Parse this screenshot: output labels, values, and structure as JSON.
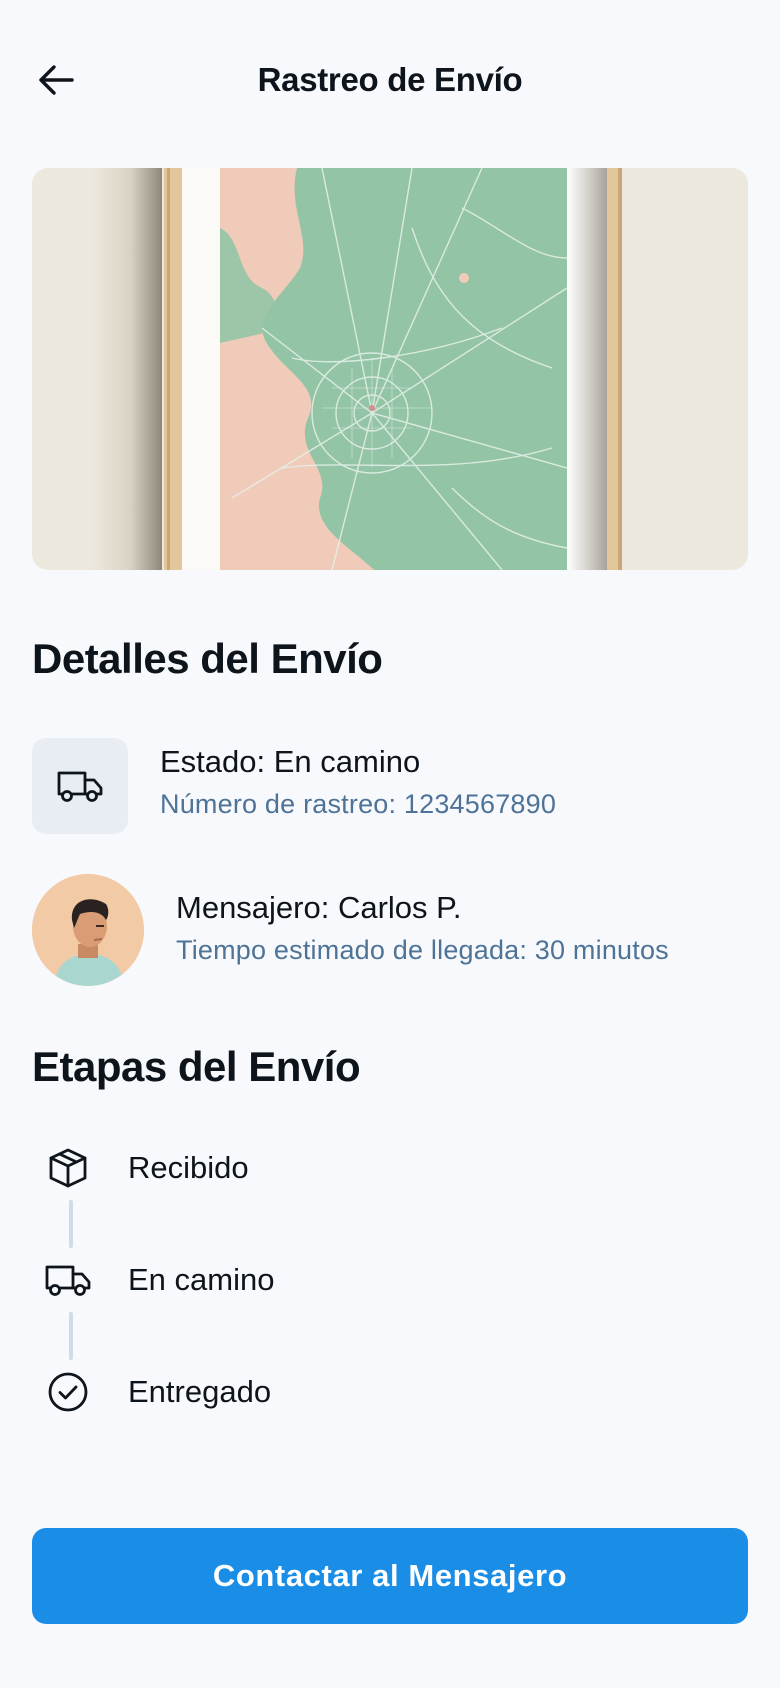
{
  "header": {
    "title": "Rastreo de Envío",
    "back_icon": "arrow-left-icon"
  },
  "map": {
    "icon": "map-image",
    "colors": {
      "land": "#f0cbb9",
      "green": "#93c4a5",
      "frame": "#e3c79a",
      "wall": "#ede8dd"
    }
  },
  "details": {
    "title": "Detalles del Envío",
    "status": {
      "icon": "truck-icon",
      "label": "Estado: En camino",
      "tracking": "Número de rastreo: 1234567890"
    },
    "courier": {
      "icon": "avatar",
      "label": "Mensajero: Carlos P.",
      "eta": "Tiempo estimado de llegada: 30 minutos"
    }
  },
  "stages": {
    "title": "Etapas del Envío",
    "items": [
      {
        "icon": "package-icon",
        "label": "Recibido"
      },
      {
        "icon": "truck-icon",
        "label": "En camino"
      },
      {
        "icon": "check-circle-icon",
        "label": "Entregado"
      }
    ]
  },
  "cta": {
    "label": "Contactar al Mensajero",
    "color": "#1a8de6"
  }
}
